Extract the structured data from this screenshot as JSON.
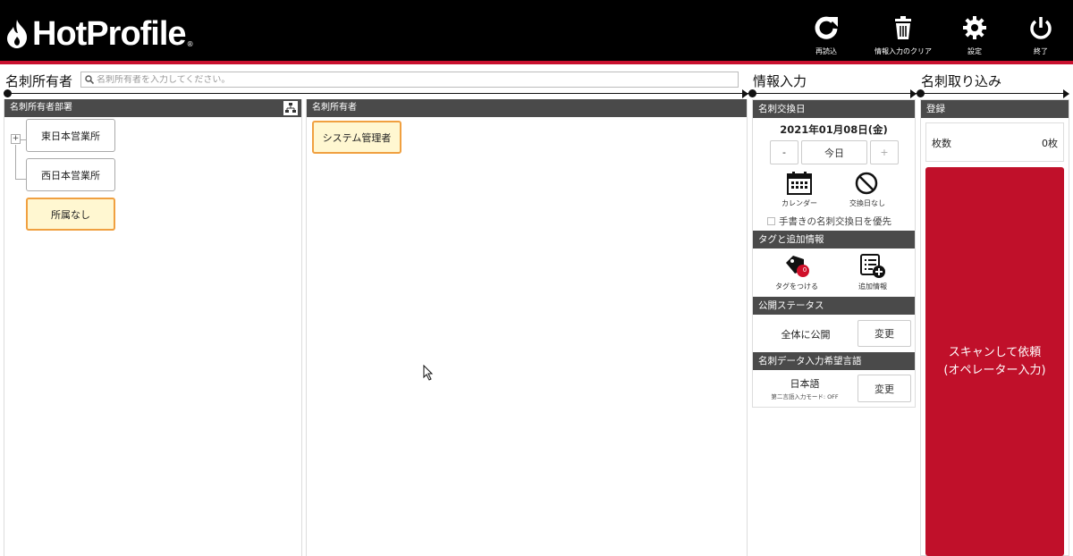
{
  "app": {
    "logo_text": "HotProfile",
    "logo_mark": "®"
  },
  "toolbar": {
    "reload_label": "再読込",
    "clear_label": "情報入力のクリア",
    "settings_label": "設定",
    "exit_label": "終了"
  },
  "sections": {
    "owner_title": "名刺所有者",
    "info_title": "情報入力",
    "import_title": "名刺取り込み"
  },
  "search": {
    "placeholder": "名刺所有者を入力してください。"
  },
  "dept_panel": {
    "header": "名刺所有者部署",
    "expander": "+",
    "items": [
      "東日本営業所",
      "西日本営業所",
      "所属なし"
    ]
  },
  "owner_panel": {
    "header": "名刺所有者",
    "items": [
      "システム管理者"
    ]
  },
  "exchange": {
    "header": "名刺交換日",
    "date": "2021年01月08日(金)",
    "minus": "-",
    "today": "今日",
    "plus": "+",
    "calendar_label": "カレンダー",
    "no_date_label": "交換日なし",
    "handwritten_label": "手書きの名刺交換日を優先"
  },
  "tags": {
    "header": "タグと追加情報",
    "tag_label": "タグをつける",
    "tag_count": "0",
    "extra_label": "追加情報"
  },
  "status": {
    "header": "公開ステータス",
    "value": "全体に公開",
    "change": "変更"
  },
  "language": {
    "header": "名刺データ入力希望言語",
    "value": "日本語",
    "sub": "第二言語入力モード: OFF",
    "change": "変更"
  },
  "register": {
    "header": "登録",
    "count_label": "枚数",
    "count_value": "0枚",
    "scan_line1": "スキャンして依頼",
    "scan_line2": "(オペレーター入力)"
  },
  "colors": {
    "brand_red": "#c8102e",
    "header_gray": "#4a4a4a",
    "selected_bg": "#fff7d1"
  }
}
